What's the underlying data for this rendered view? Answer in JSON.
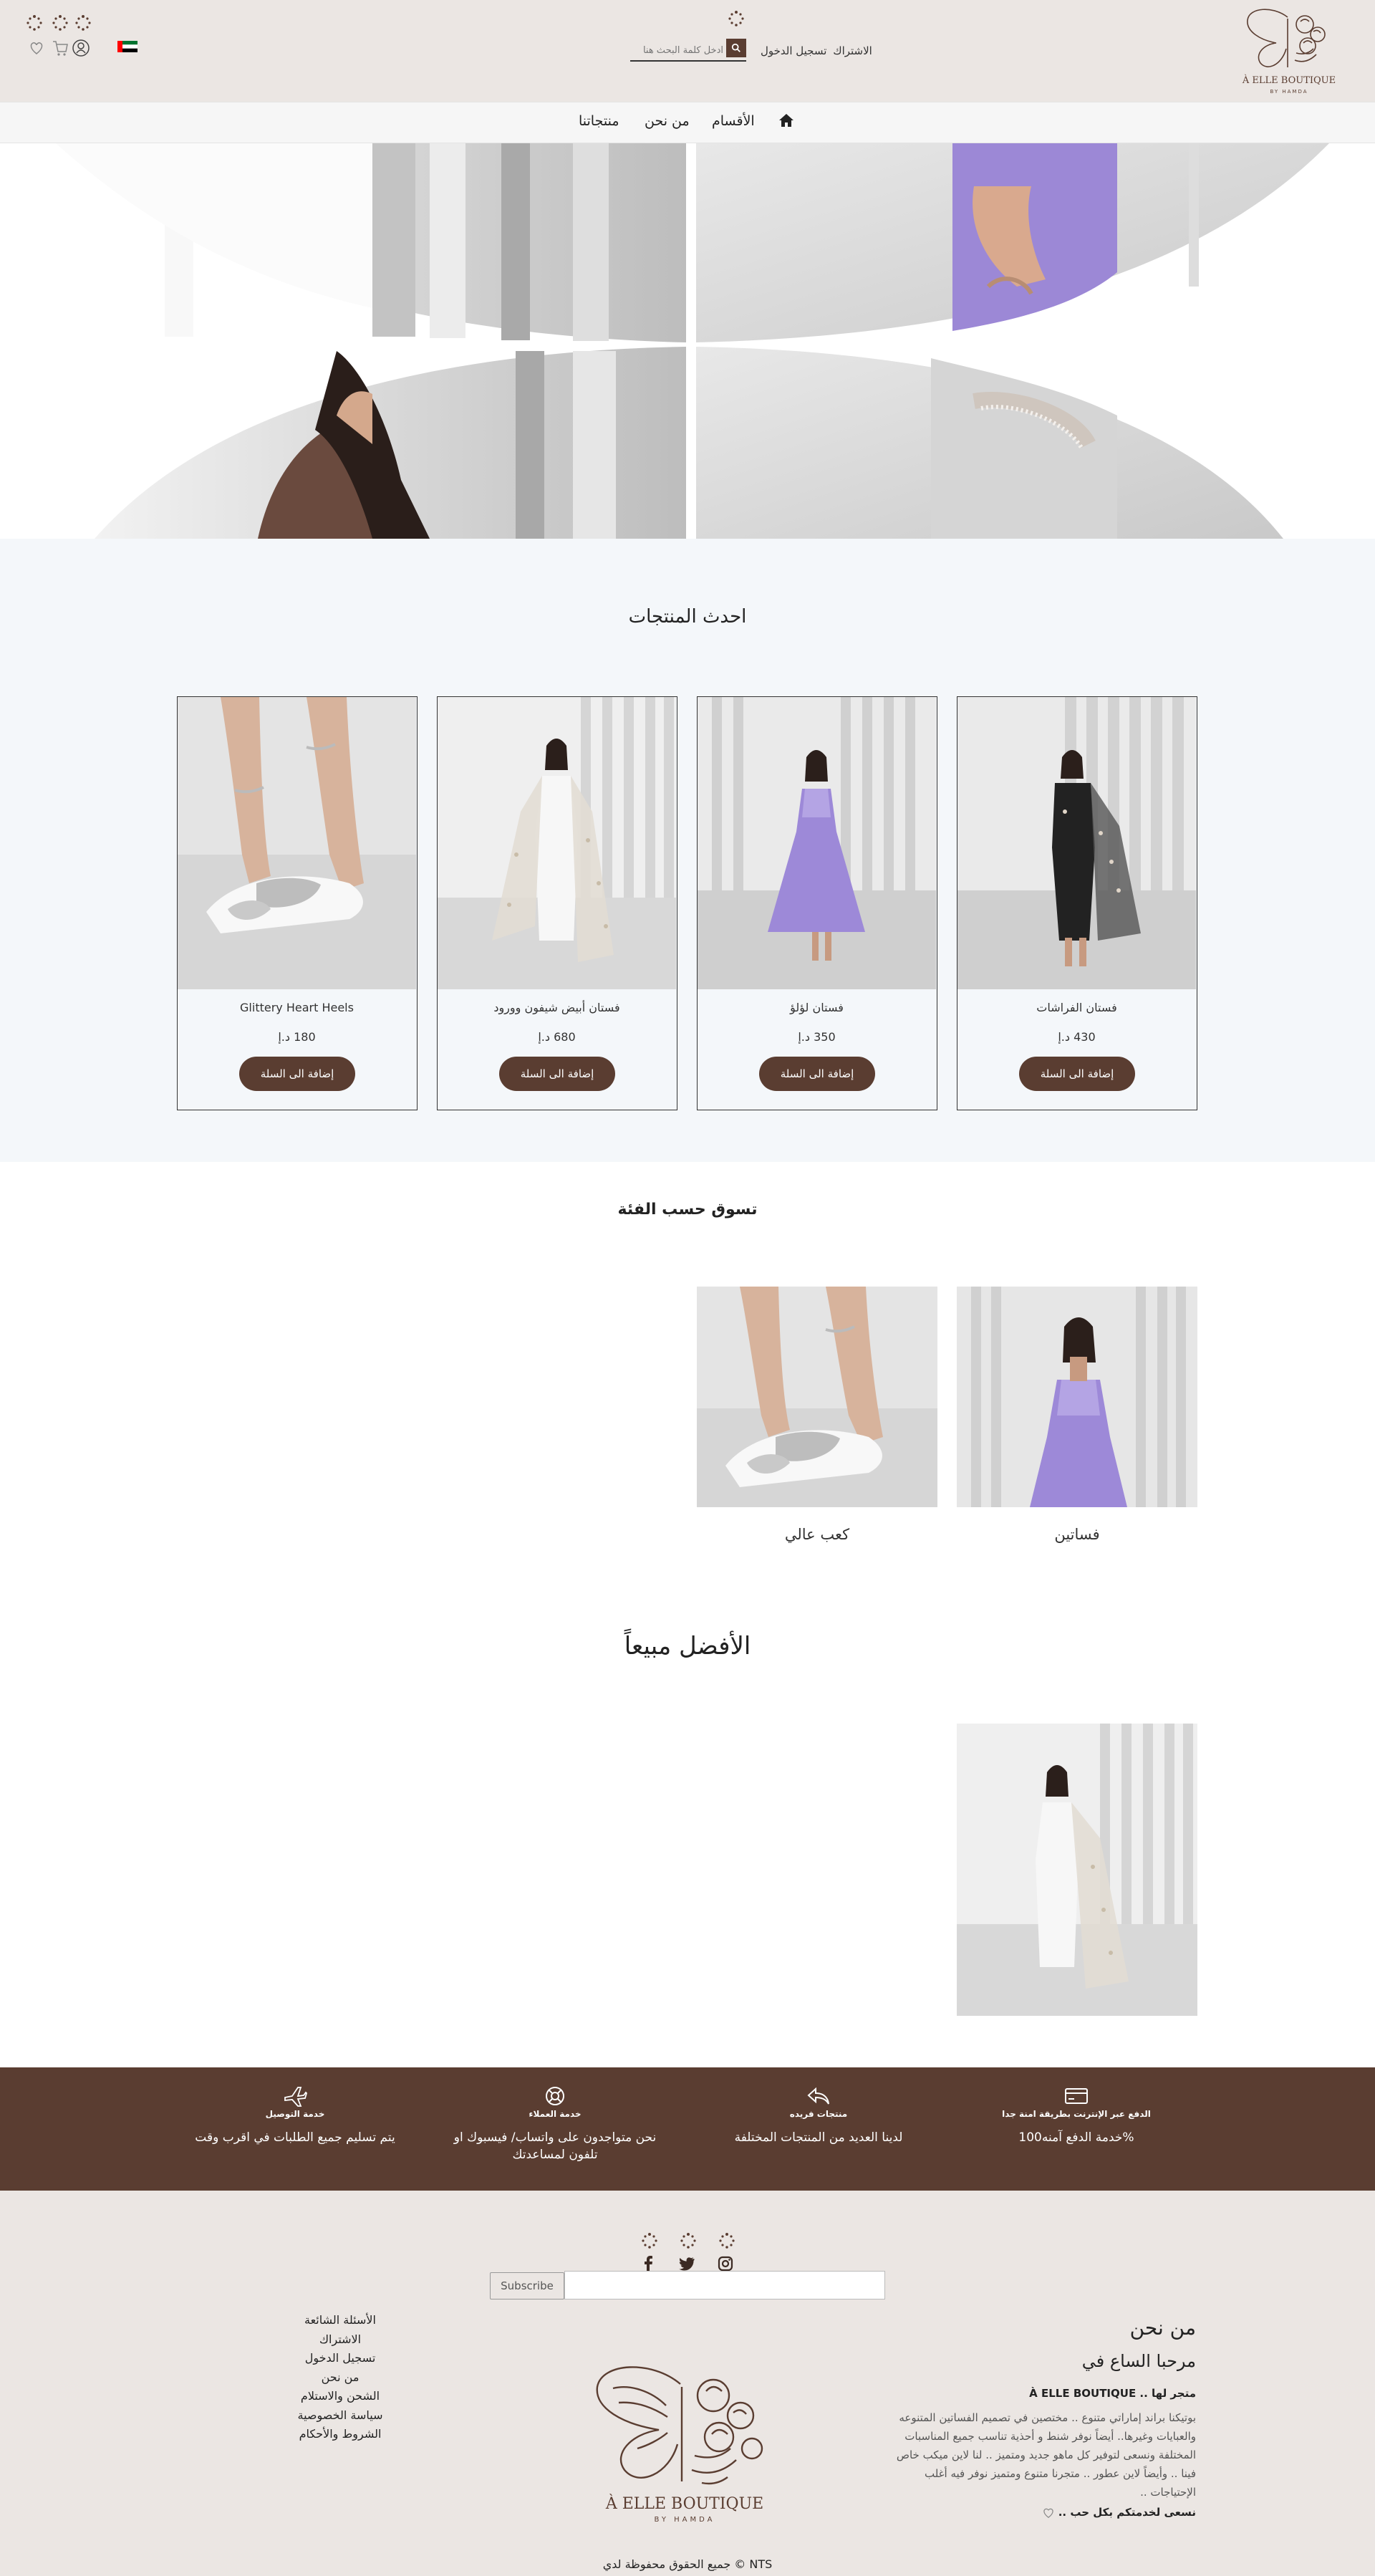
{
  "header": {
    "brand_text": "À ELLE BOUTIQUE",
    "brand_sub": "BY HAMDA",
    "auth": {
      "subscribe": "الاشتراك",
      "login": "تسجيل الدخول"
    },
    "search": {
      "placeholder": "ادخل كلمة البحث هنا",
      "button_icon": "search-icon"
    },
    "flag_icon": "uae-flag-icon",
    "icons": [
      "user-icon",
      "cart-icon",
      "heart-icon"
    ]
  },
  "nav": {
    "home_icon": "home-icon",
    "items": [
      {
        "label": "الأقسام"
      },
      {
        "label": "من نحن"
      },
      {
        "label": "منتجاتنا"
      }
    ]
  },
  "latest": {
    "title": "احدث المنتجات",
    "products": [
      {
        "name": "فستان الفراشات",
        "price": "430 د.إ",
        "button": "إضافة الى السلة"
      },
      {
        "name": "فستان لؤلؤ",
        "price": "350 د.إ",
        "button": "إضافة الى السلة"
      },
      {
        "name": "فستان أبيض شيفون وورود",
        "price": "680 د.إ",
        "button": "إضافة الى السلة"
      },
      {
        "name": "Glittery Heart Heels",
        "price": "180 د.إ",
        "button": "إضافة الى السلة"
      }
    ]
  },
  "categories": {
    "title": "تسوق حسب الفئة",
    "items": [
      {
        "label": "فساتين"
      },
      {
        "label": "كعب عالي"
      }
    ]
  },
  "best": {
    "title": "الأفضل مبيعاً"
  },
  "features": [
    {
      "icon": "credit-card-icon",
      "title": "الدفع عبر الإنترنت بطريقة امنة جدا",
      "desc": "%خدمة الدفع آمنه100"
    },
    {
      "icon": "reply-arrow-icon",
      "title": "منتجات فريده",
      "desc": "لدينا العديد من المنتجات المختلفة"
    },
    {
      "icon": "lifebuoy-icon",
      "title": "خدمة العملاء",
      "desc": "نحن متواجدون على واتساب/ فيسبوك او تلفون لمساعدتك"
    },
    {
      "icon": "airplane-icon",
      "title": "خدمة التوصيل",
      "desc": "يتم تسليم جميع الطلبات في اقرب وقت"
    }
  ],
  "footer": {
    "social": [
      "instagram-icon",
      "twitter-icon",
      "facebook-icon"
    ],
    "subscribe_button": "Subscribe",
    "links": [
      "الأسئلة الشائعة",
      "الاشتراك",
      "تسجيل الدخول",
      "من نحن",
      "الشحن والاستلام",
      "سياسة الخصوصية",
      "الشروط والأحكام"
    ],
    "about": {
      "title": "من نحن",
      "welcome": "مرحبا الساع في",
      "store": "متجر لها .. À ELLE BOUTIQUE",
      "body": "بوتيكنا براند إماراتي متنوع .. مختصين في تصميم الفساتين المتنوعه والعبايات وغيرها.. أيضاً نوفر شنط و أحذية تناسب جميع المناسبات المختلفة ونسعى لتوفير كل ماهو جديد ومتميز .. لنا لاين ميكب خاص فينا .. وأيضاً لاين عطور .. متجرنا متنوع ومتميز نوفر فيه أغلب الإحتياجات ..",
      "closing": "نسعى لخدمتكم بكل حب .."
    },
    "copyright": "NTS © جميع الحقوق محفوظة لدي"
  },
  "colors": {
    "brand": "#5a3d31",
    "header_bg": "#ebe6e3",
    "section_bg": "#f4f7fa"
  }
}
